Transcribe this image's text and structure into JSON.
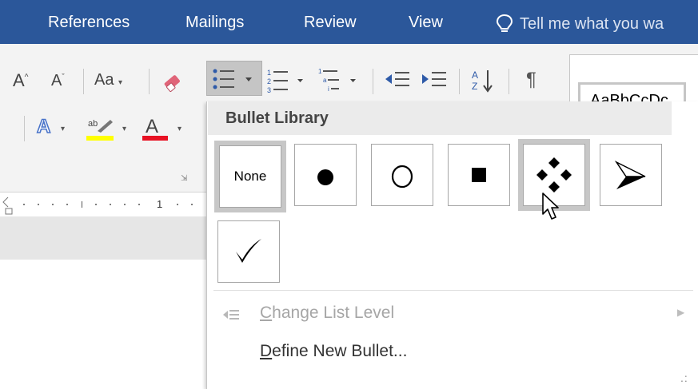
{
  "tabs": [
    {
      "label": "References"
    },
    {
      "label": "Mailings"
    },
    {
      "label": "Review"
    },
    {
      "label": "View"
    }
  ],
  "tell_me": "Tell me what you wa",
  "ribbon": {
    "font_case_label": "Aa",
    "style_sample": "AaBbCcDc",
    "ruler_mark": "1"
  },
  "bullet_panel": {
    "header": "Bullet Library",
    "tiles": [
      {
        "name": "none",
        "label": "None"
      },
      {
        "name": "filled-circle",
        "glyph": "●"
      },
      {
        "name": "hollow-circle",
        "glyph": "○"
      },
      {
        "name": "filled-square",
        "glyph": "■"
      },
      {
        "name": "four-diamond",
        "glyph": "❖"
      },
      {
        "name": "arrowhead",
        "glyph": "➤"
      },
      {
        "name": "checkmark",
        "glyph": "✓"
      }
    ],
    "menu": [
      {
        "label_first": "C",
        "label_rest": "hange List Level",
        "enabled": false
      },
      {
        "label_first": "D",
        "label_rest": "efine New Bullet...",
        "enabled": true
      }
    ]
  },
  "colors": {
    "tab_bar": "#2b579a",
    "highlight": "#ffff00",
    "font_color": "#e81123",
    "text_effect": "#4a74c9"
  }
}
